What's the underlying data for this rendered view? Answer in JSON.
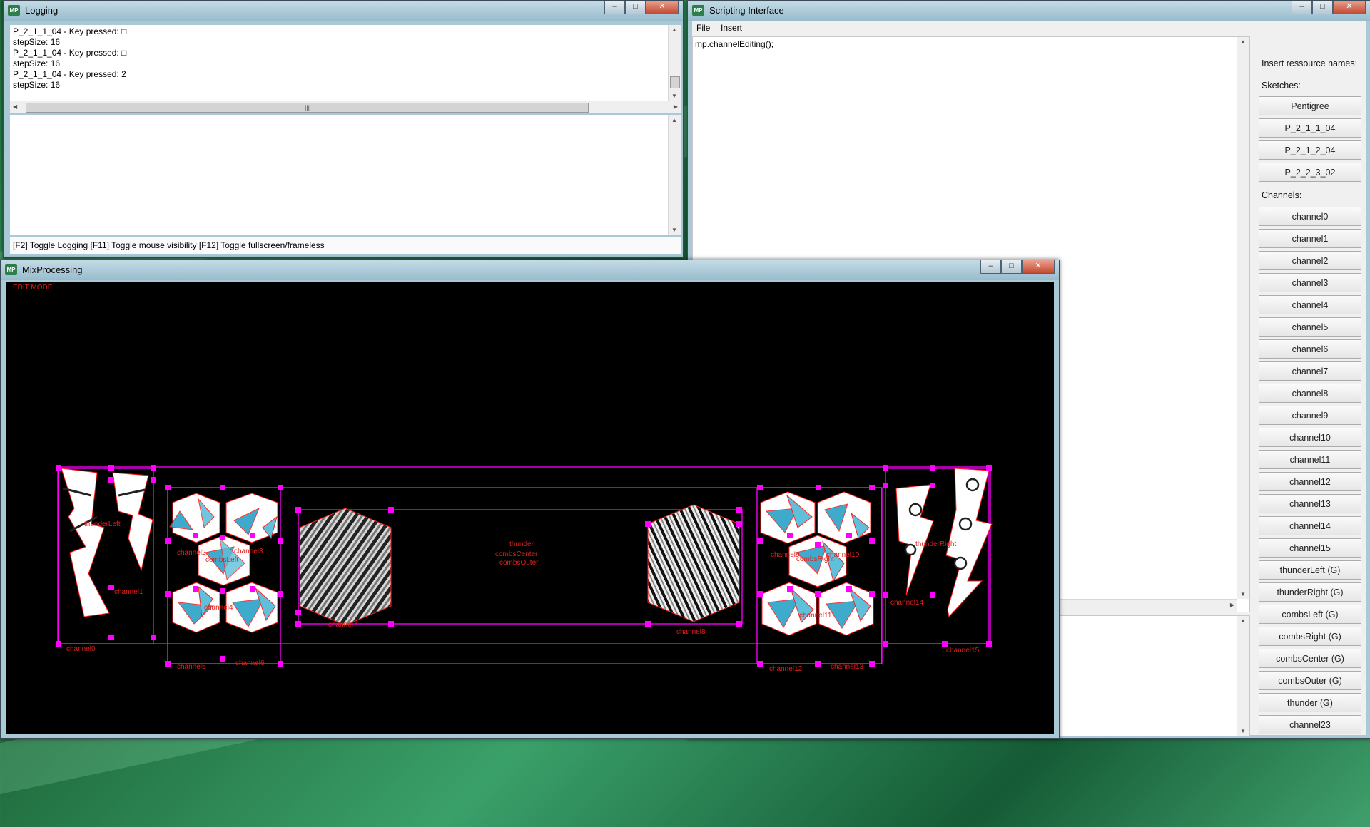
{
  "logging": {
    "title": "Logging",
    "app_icon": "MP",
    "lines": [
      "P_2_1_1_04 - Key pressed: □",
      "stepSize: 16",
      "P_2_1_1_04 - Key pressed: □",
      "stepSize: 16",
      "P_2_1_1_04 - Key pressed: 2",
      "stepSize: 16"
    ],
    "hscroll_grip": "|||",
    "status": "[F2] Toggle Logging [F11] Toggle mouse visibility [F12] Toggle fullscreen/frameless"
  },
  "scripting": {
    "title": "Scripting Interface",
    "app_icon": "MP",
    "menu": [
      "File",
      "Insert"
    ],
    "code": "mp.channelEditing();",
    "resources_header": "Insert ressource names:",
    "sketches_label": "Sketches:",
    "sketches": [
      "Pentigree",
      "P_2_1_1_04",
      "P_2_1_2_04",
      "P_2_2_3_02"
    ],
    "channels_label": "Channels:",
    "channels": [
      "channel0",
      "channel1",
      "channel2",
      "channel3",
      "channel4",
      "channel5",
      "channel6",
      "channel7",
      "channel8",
      "channel9",
      "channel10",
      "channel11",
      "channel12",
      "channel13",
      "channel14",
      "channel15",
      "thunderLeft (G)",
      "thunderRight (G)",
      "combsLeft (G)",
      "combsRight (G)",
      "combsCenter (G)",
      "combsOuter (G)",
      "thunder (G)",
      "channel23"
    ]
  },
  "mixprocessing": {
    "title": "MixProcessing",
    "app_icon": "MP",
    "mode_label": "EDIT MODE",
    "labels": {
      "thunderLeft": "thunderLeft",
      "channel0": "channel0",
      "channel1": "channel1",
      "channel2": "channel2",
      "channel3": "channel3",
      "combsLeft": "combsLeft",
      "channel4": "channel4",
      "channel5": "channel5",
      "channel6": "channel6",
      "channel7": "channel7",
      "thunder": "thunder",
      "combsCenter": "combsCenter",
      "combsOuter": "combsOuter",
      "channel8": "channel8",
      "channel9": "channel9",
      "channel10": "channel10",
      "combsRight": "combsRight",
      "channel11": "channel11",
      "channel12": "channel12",
      "channel13": "channel13",
      "channel14": "channel14",
      "thunderRight": "thunderRight",
      "channel15": "channel15"
    }
  },
  "caption_buttons": {
    "minimize": "–",
    "maximize": "□",
    "close": "✕"
  },
  "colors": {
    "handle": "#ff00ff",
    "label": "#e0201a",
    "cyan": "#2aa3c7"
  }
}
